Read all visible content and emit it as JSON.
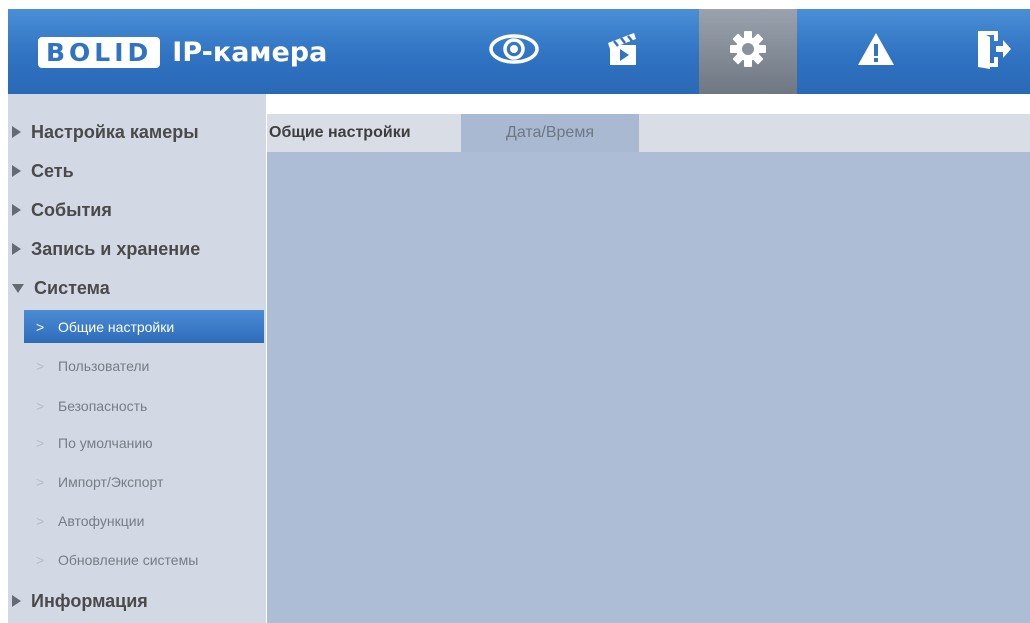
{
  "header": {
    "logo_text": "BOLID",
    "app_title": "IP-камера",
    "nav": [
      {
        "icon": "eye-icon",
        "active": false
      },
      {
        "icon": "clapperboard-icon",
        "active": false
      },
      {
        "icon": "gear-icon",
        "active": true
      },
      {
        "icon": "warning-icon",
        "active": false
      },
      {
        "icon": "logout-icon",
        "active": false
      }
    ]
  },
  "sidebar": {
    "sections": [
      {
        "label": "Настройка камеры",
        "expanded": false
      },
      {
        "label": "Сеть",
        "expanded": false
      },
      {
        "label": "События",
        "expanded": false
      },
      {
        "label": "Запись и хранение",
        "expanded": false
      },
      {
        "label": "Система",
        "expanded": true
      },
      {
        "label": "Информация",
        "expanded": false
      }
    ],
    "system_items": [
      {
        "label": "Общие настройки",
        "active": true
      },
      {
        "label": "Пользователи",
        "active": false
      },
      {
        "label": "Безопасность",
        "active": false
      },
      {
        "label": "По умолчанию",
        "active": false
      },
      {
        "label": "Импорт/Экспорт",
        "active": false
      },
      {
        "label": "Автофункции",
        "active": false
      },
      {
        "label": "Обновление системы",
        "active": false
      }
    ]
  },
  "main": {
    "tabs": [
      {
        "label": "Общие настройки",
        "active": true
      },
      {
        "label": "Дата/Время",
        "active": false
      }
    ]
  },
  "colors": {
    "header_blue": "#2f73c2",
    "panel_blue": "#adbdd6",
    "sidebar_gray": "#d3d9e4",
    "active_item": "#3a7cc8"
  }
}
